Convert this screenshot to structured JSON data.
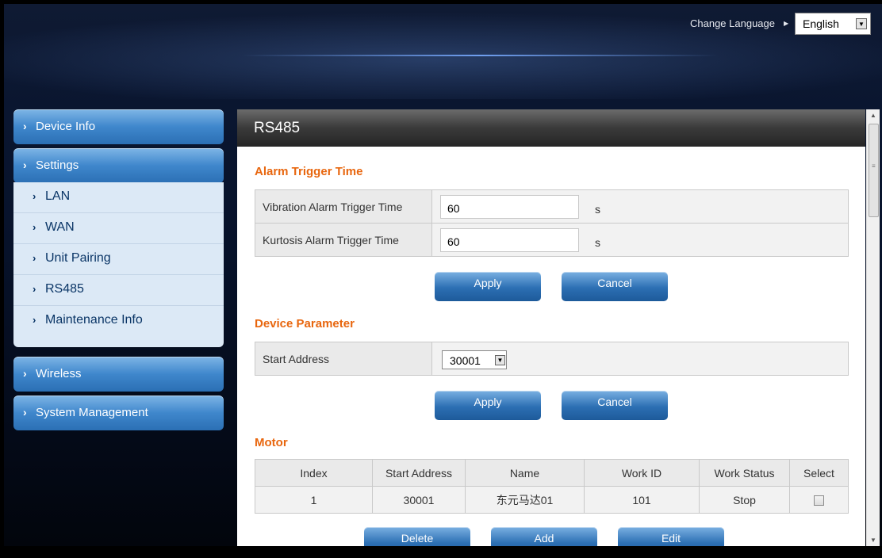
{
  "header": {
    "change_language_label": "Change Language",
    "language_value": "English"
  },
  "sidebar": {
    "items": [
      {
        "label": "Device Info"
      },
      {
        "label": "Settings"
      },
      {
        "label": "Wireless"
      },
      {
        "label": "System Management"
      }
    ],
    "settings_sub": [
      {
        "label": "LAN"
      },
      {
        "label": "WAN"
      },
      {
        "label": "Unit Pairing"
      },
      {
        "label": "RS485"
      },
      {
        "label": "Maintenance Info"
      }
    ]
  },
  "main": {
    "title": "RS485",
    "alarm": {
      "section_title": "Alarm Trigger Time",
      "rows": [
        {
          "label": "Vibration Alarm Trigger Time",
          "value": "60",
          "unit": "s"
        },
        {
          "label": "Kurtosis Alarm Trigger Time",
          "value": "60",
          "unit": "s"
        }
      ],
      "apply_label": "Apply",
      "cancel_label": "Cancel"
    },
    "device": {
      "section_title": "Device Parameter",
      "start_address_label": "Start Address",
      "start_address_value": "30001",
      "apply_label": "Apply",
      "cancel_label": "Cancel"
    },
    "motor": {
      "section_title": "Motor",
      "columns": [
        "Index",
        "Start Address",
        "Name",
        "Work ID",
        "Work Status",
        "Select"
      ],
      "rows": [
        {
          "index": "1",
          "start_address": "30001",
          "name": "东元马达01",
          "work_id": "101",
          "work_status": "Stop",
          "selected": false
        }
      ],
      "delete_label": "Delete",
      "add_label": "Add",
      "edit_label": "Edit"
    }
  }
}
